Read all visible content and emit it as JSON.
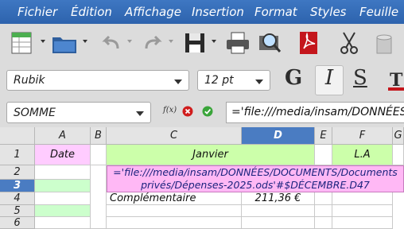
{
  "menu": {
    "items": [
      "Fichier",
      "Édition",
      "Affichage",
      "Insertion",
      "Format",
      "Styles",
      "Feuille"
    ]
  },
  "font_bar": {
    "font_name": "Rubik",
    "font_size": "12 pt",
    "bold_glyph": "G",
    "italic_glyph": "I",
    "underline_glyph": "S"
  },
  "formula_bar": {
    "name_box": "SOMME",
    "fx_label": "f(x)",
    "content": "='file:///media/insam/DONNÉES/DOCUMENTS/Documents privés/Dépenses-2025.ods'#$DÉCEMBRE.D47"
  },
  "grid": {
    "columns": [
      "A",
      "B",
      "C",
      "D",
      "E",
      "F",
      "G"
    ],
    "rows": [
      "1",
      "2",
      "3",
      "4",
      "5",
      "6"
    ],
    "cells": {
      "A1": "Date",
      "C1": "Janvier",
      "F1": "L.A",
      "C2_edit_line1": "='file:///media/insam/DONNÉES/DOCUMENTS/Documents",
      "C2_edit_line2": "privés/Dépenses-2025.ods'#$DÉCEMBRE.D47",
      "C4": "Complémentaire",
      "D4": "211,36 €"
    }
  },
  "colors": {
    "menu_bg": "#3372be",
    "header_pink": "#ffccff",
    "header_green": "#ccffaa",
    "edit_pink": "#ffb8f5",
    "row_green": "#ccffcc",
    "selected_header": "#4a7cc2"
  }
}
